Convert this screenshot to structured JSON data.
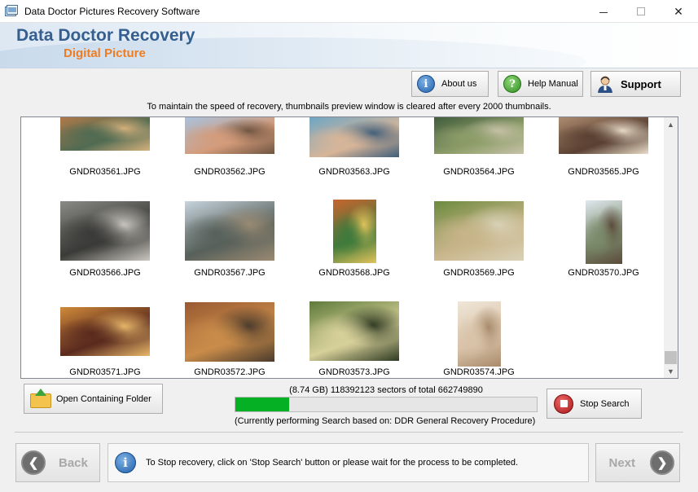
{
  "window": {
    "title": "Data Doctor Pictures Recovery Software"
  },
  "header": {
    "brand_title": "Data Doctor Recovery",
    "brand_subtitle": "Digital Picture"
  },
  "toolbar": {
    "about_label": "About us",
    "help_label": "Help Manual",
    "support_label": "Support"
  },
  "notice": "To maintain the speed of recovery, thumbnails preview window is cleared after every 2000 thumbnails.",
  "thumbnails": [
    {
      "name": "GNDR03561.JPG",
      "colors": [
        "#b87a48",
        "#4f6b52",
        "#d6b07c"
      ]
    },
    {
      "name": "GNDR03562.JPG",
      "colors": [
        "#a7c3e0",
        "#d49b7a",
        "#6e5440"
      ]
    },
    {
      "name": "GNDR03563.JPG",
      "colors": [
        "#6fa6c4",
        "#d8b598",
        "#3e5e7a"
      ]
    },
    {
      "name": "GNDR03564.JPG",
      "colors": [
        "#3f5a3a",
        "#8e9e6a",
        "#c7c2a8"
      ]
    },
    {
      "name": "GNDR03565.JPG",
      "colors": [
        "#b08f72",
        "#5a4032",
        "#e8dcc8"
      ]
    },
    {
      "name": "GNDR03566.JPG",
      "colors": [
        "#8a8a86",
        "#3a3a38",
        "#c9c6be"
      ]
    },
    {
      "name": "GNDR03567.JPG",
      "colors": [
        "#c7d4de",
        "#57605a",
        "#9a8a72"
      ]
    },
    {
      "name": "GNDR03568.JPG",
      "colors": [
        "#c8642e",
        "#3f7a3c",
        "#e2c35a"
      ]
    },
    {
      "name": "GNDR03569.JPG",
      "colors": [
        "#6c8a3e",
        "#c9b58a",
        "#d9d2b8"
      ]
    },
    {
      "name": "GNDR03570.JPG",
      "colors": [
        "#dfe8ee",
        "#7a8a6a",
        "#5a4a3a"
      ]
    },
    {
      "name": "GNDR03571.JPG",
      "colors": [
        "#d08a3a",
        "#5a2a1e",
        "#e8b86a"
      ]
    },
    {
      "name": "GNDR03572.JPG",
      "colors": [
        "#9a5a32",
        "#c98c4a",
        "#4a3a2c"
      ]
    },
    {
      "name": "GNDR03573.JPG",
      "colors": [
        "#5e7a3a",
        "#d7d09a",
        "#2e3a22"
      ]
    },
    {
      "name": "GNDR03574.JPG",
      "colors": [
        "#f0e6d8",
        "#d8c2a8",
        "#a88a6a"
      ]
    }
  ],
  "actions": {
    "open_folder_label": "Open Containing Folder",
    "stop_label": "Stop Search"
  },
  "progress": {
    "sector_text": "(8.74 GB) 118392123  sectors  of  total 662749890",
    "fraction": 0.1786,
    "procedure_text": "(Currently performing Search based on:  DDR General Recovery Procedure)"
  },
  "footer": {
    "back_label": "Back",
    "next_label": "Next",
    "info_text": "To Stop recovery, click on 'Stop Search' button or please wait for the process to be completed."
  }
}
